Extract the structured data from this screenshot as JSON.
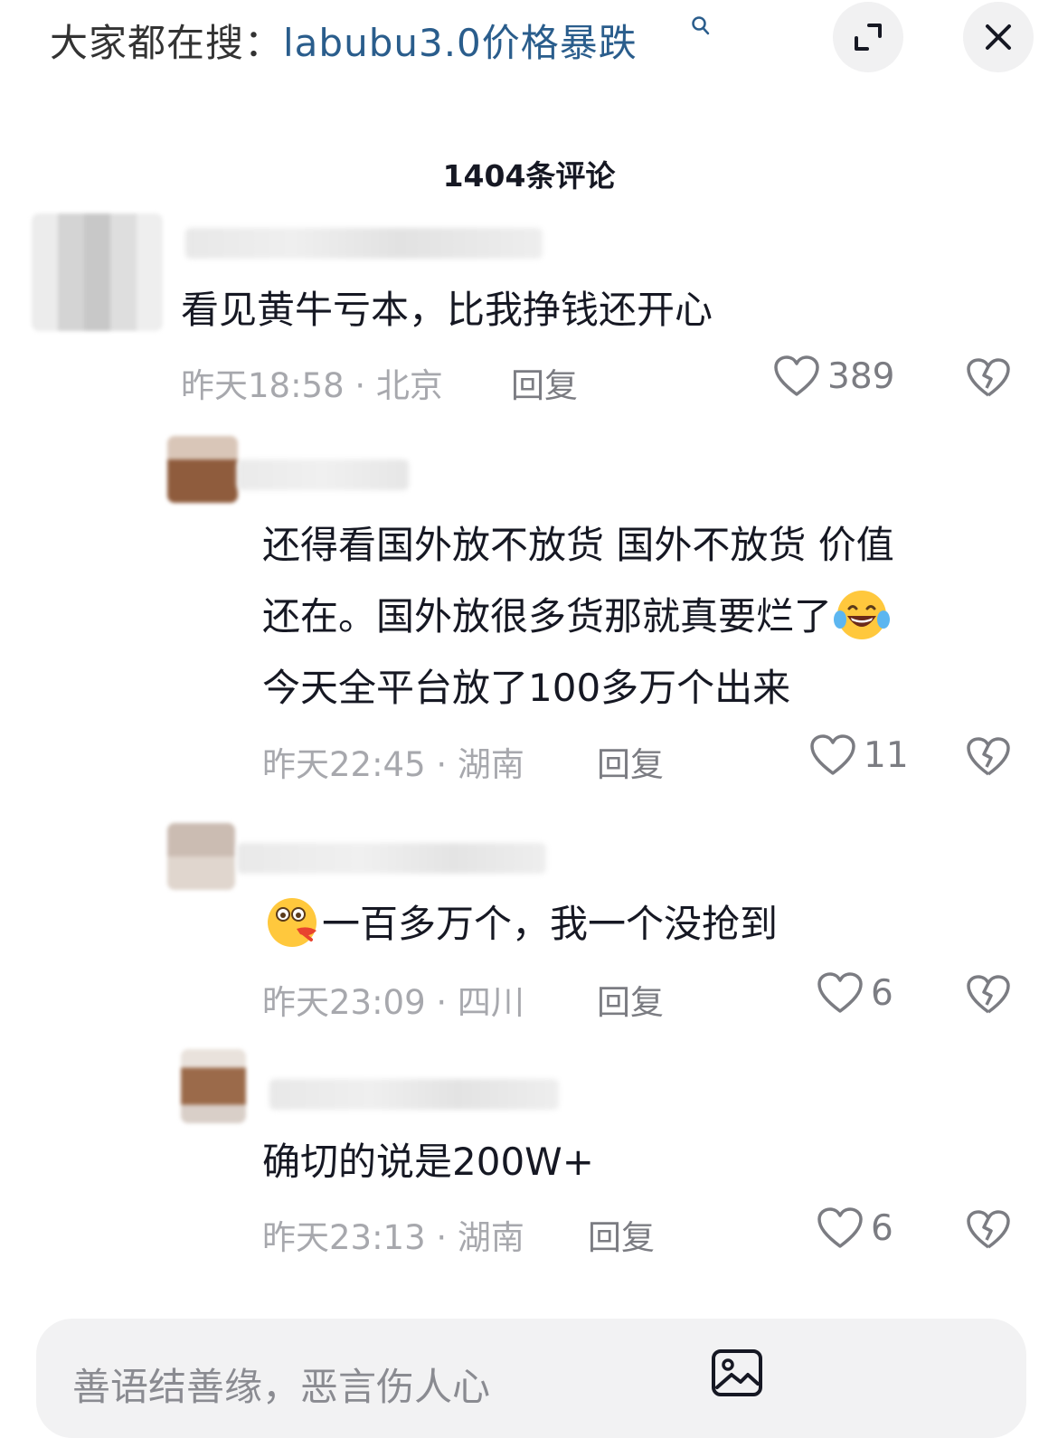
{
  "header": {
    "search_prefix": "大家都在搜：",
    "search_keyword": "labubu3.0价格暴跌"
  },
  "comment_count": "1404条评论",
  "comments": [
    {
      "text_lines": [
        "看见黄牛亏本，比我挣钱还开心"
      ],
      "meta": "昨天18:58 · 北京",
      "reply": "回复",
      "likes": "389"
    },
    {
      "text_lines": [
        "还得看国外放不放货 国外不放货 价值",
        "还在。国外放很多货那就真要烂了",
        "今天全平台放了100多万个出来"
      ],
      "emoji": "laughing-tears-emoji",
      "meta": "昨天22:45 · 湖南",
      "reply": "回复",
      "likes": "11"
    },
    {
      "text_lines": [
        "一百多万个，我一个没抢到"
      ],
      "emoji": "drooling-face-emoji",
      "meta": "昨天23:09 · 四川",
      "reply": "回复",
      "likes": "6"
    },
    {
      "text_lines": [
        "确切的说是200W+"
      ],
      "meta": "昨天23:13 · 湖南",
      "reply": "回复",
      "likes": "6"
    }
  ],
  "input": {
    "placeholder": "善语结善缘，恶言伤人心"
  },
  "icons": {
    "expand": "expand-icon",
    "close": "close-icon",
    "like": "heart-icon",
    "dislike": "broken-heart-icon",
    "image": "image-icon"
  },
  "colors": {
    "keyword": "#2a5d8c",
    "meta": "#a7a8ad",
    "input_bg": "#f2f2f3"
  }
}
